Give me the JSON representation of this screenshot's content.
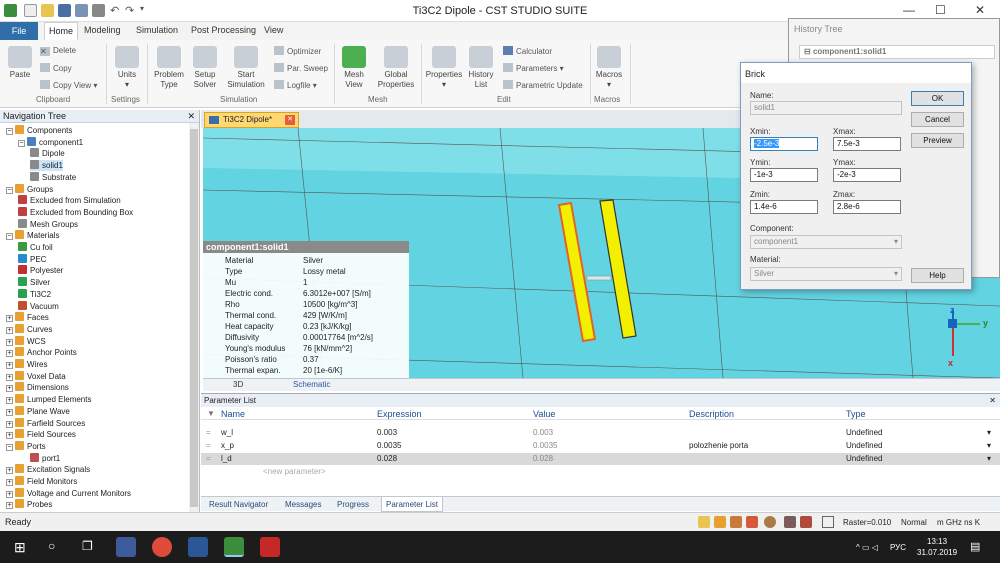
{
  "window": {
    "title": "Ti3C2 Dipole - CST STUDIO SUITE"
  },
  "ribbon_tabs": {
    "file": "File",
    "home": "Home",
    "modeling": "Modeling",
    "simulation": "Simulation",
    "post": "Post Processing",
    "view": "View"
  },
  "ribbon": {
    "paste": "Paste",
    "delete": "Delete",
    "copy": "Copy",
    "copy_view": "Copy View",
    "clipboard": "Clipboard",
    "units": "Units",
    "settings": "Settings",
    "problem_type": "Problem\nType",
    "setup_solver": "Setup\nSolver",
    "start_sim": "Start\nSimulation",
    "optimizer": "Optimizer",
    "par_sweep": "Par. Sweep",
    "logfile": "Logfile",
    "simulation": "Simulation",
    "mesh_view": "Mesh\nView",
    "global_props": "Global\nProperties",
    "mesh": "Mesh",
    "properties": "Properties",
    "history_list": "History\nList",
    "calculator": "Calculator",
    "parameters": "Parameters",
    "param_update": "Parametric Update",
    "edit": "Edit",
    "macros": "Macros",
    "macros_group": "Macros"
  },
  "nav": {
    "title": "Navigation Tree",
    "items": [
      {
        "label": "Components"
      },
      {
        "label": "component1"
      },
      {
        "label": "Dipole"
      },
      {
        "label": "solid1"
      },
      {
        "label": "Substrate"
      },
      {
        "label": "Groups"
      },
      {
        "label": "Excluded from Simulation"
      },
      {
        "label": "Excluded from Bounding Box"
      },
      {
        "label": "Mesh Groups"
      },
      {
        "label": "Materials"
      },
      {
        "label": "Cu foil"
      },
      {
        "label": "PEC"
      },
      {
        "label": "Polyester"
      },
      {
        "label": "Silver"
      },
      {
        "label": "Ti3C2"
      },
      {
        "label": "Vacuum"
      },
      {
        "label": "Faces"
      },
      {
        "label": "Curves"
      },
      {
        "label": "WCS"
      },
      {
        "label": "Anchor Points"
      },
      {
        "label": "Wires"
      },
      {
        "label": "Voxel Data"
      },
      {
        "label": "Dimensions"
      },
      {
        "label": "Lumped Elements"
      },
      {
        "label": "Plane Wave"
      },
      {
        "label": "Farfield Sources"
      },
      {
        "label": "Field Sources"
      },
      {
        "label": "Ports"
      },
      {
        "label": "port1"
      },
      {
        "label": "Excitation Signals"
      },
      {
        "label": "Field Monitors"
      },
      {
        "label": "Voltage and Current Monitors"
      },
      {
        "label": "Probes"
      }
    ]
  },
  "doc_tab": "Ti3C2 Dipole*",
  "info": {
    "title": "component1:solid1",
    "rows": [
      {
        "k": "Material",
        "v": "Silver"
      },
      {
        "k": "Type",
        "v": "Lossy metal"
      },
      {
        "k": "Mu",
        "v": "1"
      },
      {
        "k": "Electric cond.",
        "v": "6.3012e+007 [S/m]"
      },
      {
        "k": "Rho",
        "v": "10500 [kg/m^3]"
      },
      {
        "k": "Thermal cond.",
        "v": "429 [W/K/m]"
      },
      {
        "k": "Heat capacity",
        "v": "0.23 [kJ/K/kg]"
      },
      {
        "k": "Diffusivity",
        "v": "0.00017764 [m^2/s]"
      },
      {
        "k": "Young's modulus",
        "v": "76 [kN/mm^2]"
      },
      {
        "k": "Poisson's ratio",
        "v": "0.37"
      },
      {
        "k": "Thermal expan.",
        "v": "20 [1e-6/K]"
      }
    ]
  },
  "view_tabs": {
    "t3d": "3D",
    "schematic": "Schematic"
  },
  "axes": {
    "x": "x",
    "y": "y",
    "z": "z"
  },
  "params": {
    "title": "Parameter List",
    "cols": {
      "name": "Name",
      "expr": "Expression",
      "value": "Value",
      "desc": "Description",
      "type": "Type"
    },
    "rows": [
      {
        "name": "w_l",
        "expr": "0.003",
        "value": "0.003",
        "desc": "",
        "type": "Undefined"
      },
      {
        "name": "x_p",
        "expr": "0.0035",
        "value": "0.0035",
        "desc": "polozhenie porta",
        "type": "Undefined"
      },
      {
        "name": "l_d",
        "expr": "0.028",
        "value": "0.028",
        "desc": "",
        "type": "Undefined"
      }
    ],
    "new": "<new parameter>"
  },
  "bottom_tabs": {
    "result": "Result Navigator",
    "messages": "Messages",
    "progress": "Progress",
    "params": "Parameter List"
  },
  "status": {
    "ready": "Ready",
    "raster": "Raster=0.010",
    "normal": "Normal",
    "units": "m GHz ns K"
  },
  "history": {
    "title": "History Tree",
    "item": "component1:solid1"
  },
  "brick": {
    "title": "Brick",
    "name_label": "Name:",
    "name": "solid1",
    "xmin_label": "Xmin:",
    "xmin": "-2.5e-3",
    "xmax_label": "Xmax:",
    "xmax": "7.5e-3",
    "ymin_label": "Ymin:",
    "ymin": "-1e-3",
    "ymax_label": "Ymax:",
    "ymax": "-2e-3",
    "zmin_label": "Zmin:",
    "zmin": "1.4e-6",
    "zmax_label": "Zmax:",
    "zmax": "2.8e-6",
    "component_label": "Component:",
    "component": "component1",
    "material_label": "Material:",
    "material": "Silver",
    "ok": "OK",
    "cancel": "Cancel",
    "preview": "Preview",
    "help": "Help"
  },
  "taskbar": {
    "lang": "РУС",
    "time": "13:13",
    "date": "31.07.2019"
  }
}
